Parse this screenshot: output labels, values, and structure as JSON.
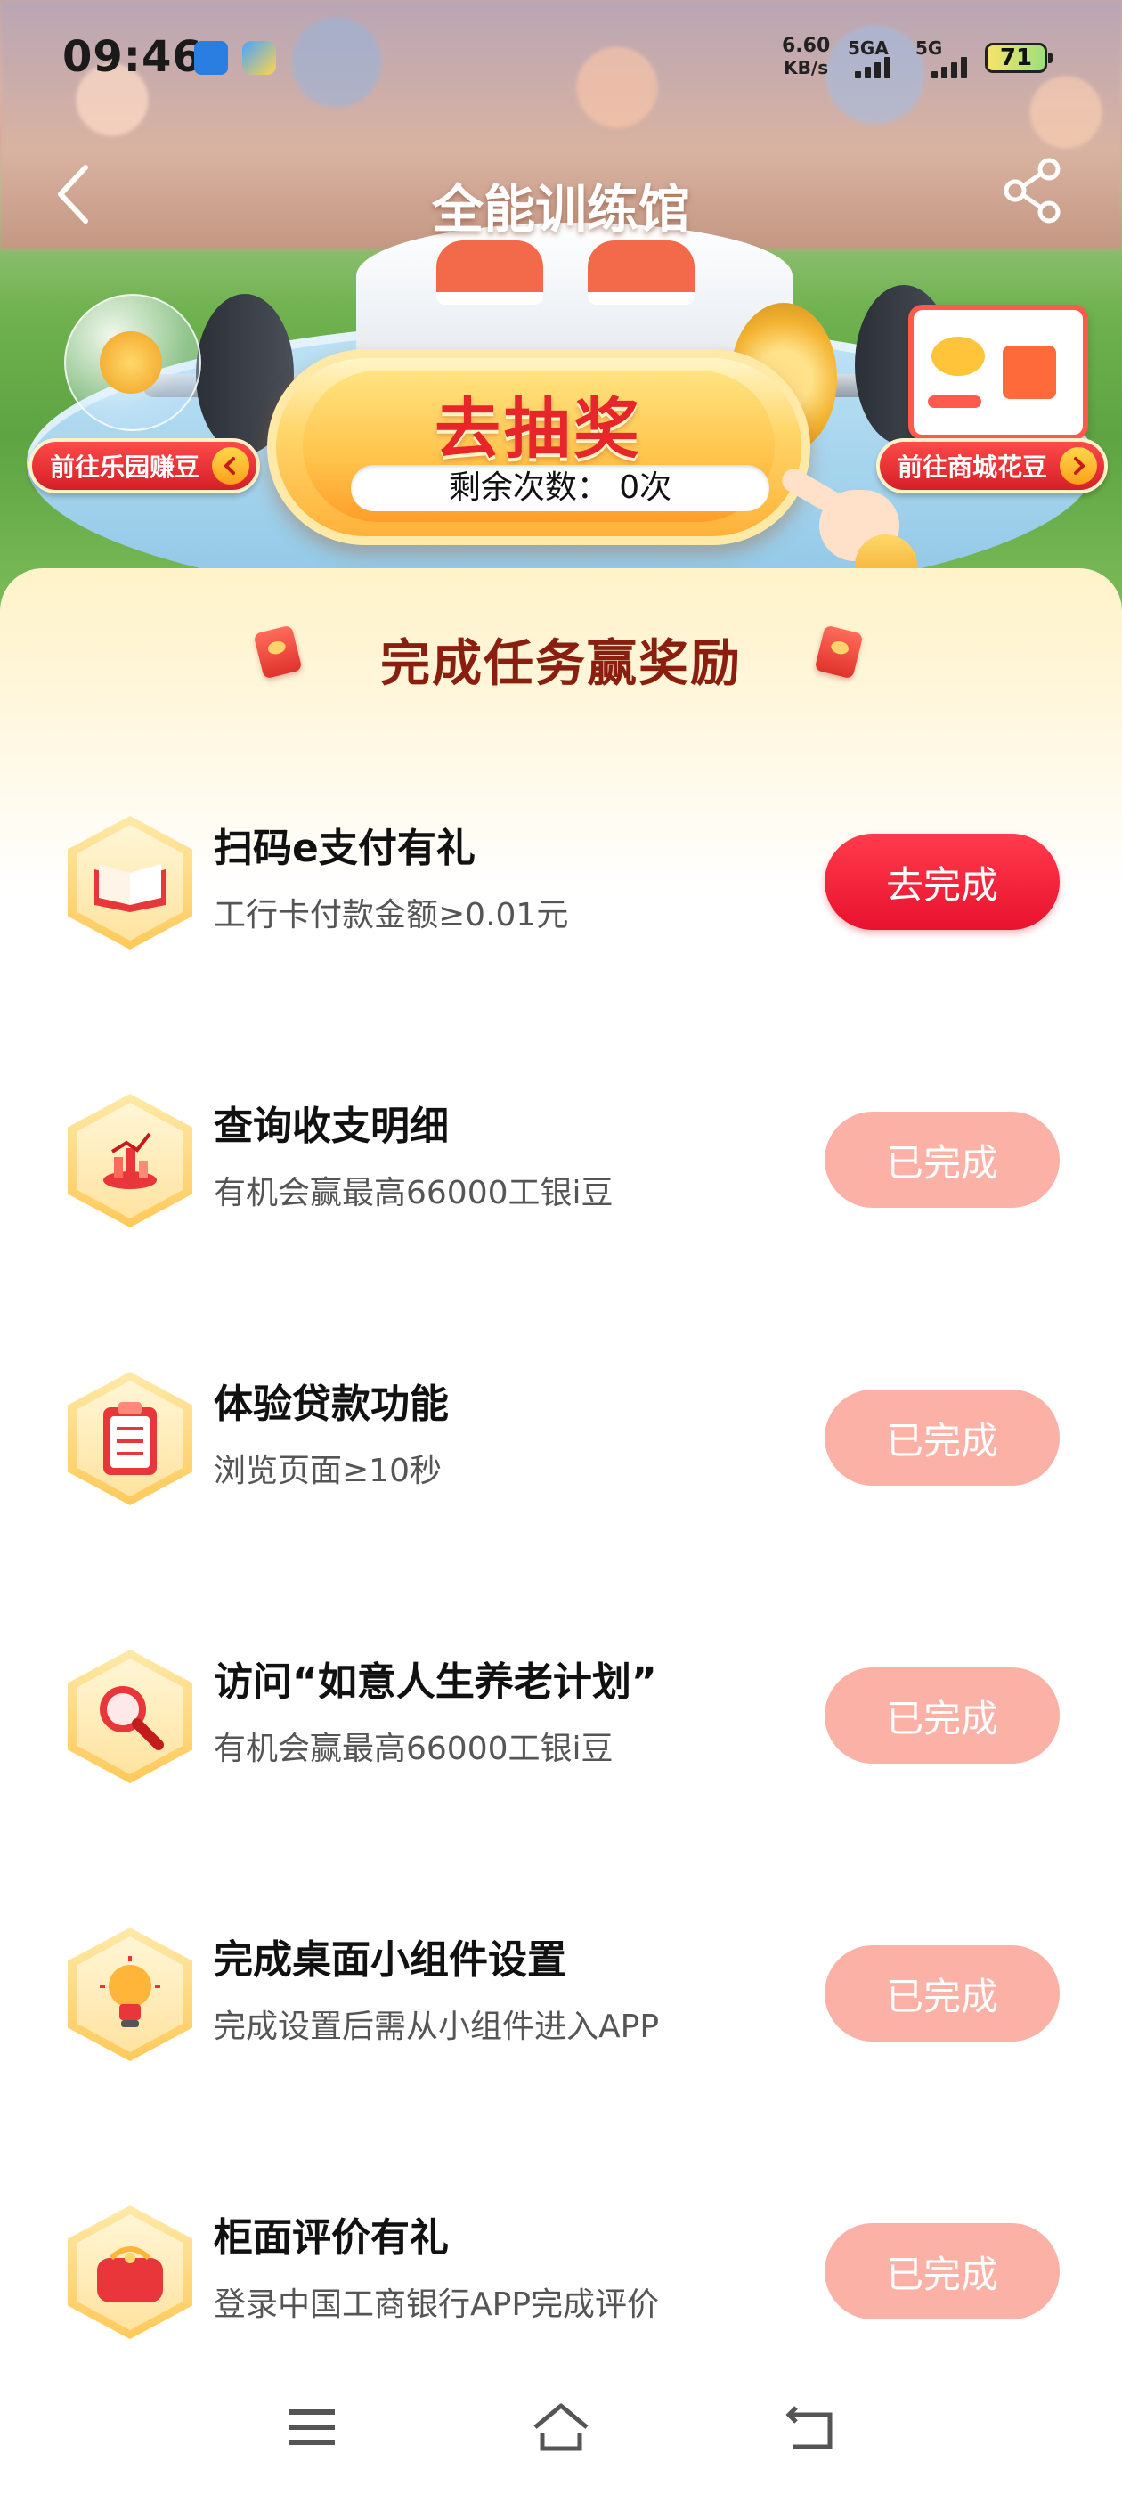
{
  "status_bar": {
    "time": "09:46",
    "net_speed_value": "6.60",
    "net_speed_unit": "KB/s",
    "network_1": "5GA",
    "network_2": "5G",
    "battery": "71"
  },
  "nav": {
    "title": "全能训练馆"
  },
  "hero": {
    "left_link": "前往乐园赚豆",
    "right_link": "前往商城花豆",
    "lottery_title": "去抽奖",
    "remaining": "剩余次数： 0次"
  },
  "tasks_panel": {
    "title": "完成任务赢奖励",
    "tasks": [
      {
        "title": "扫码e支付有礼",
        "desc": "工行卡付款金额≥0.01元",
        "button": "去完成",
        "icon": "book-icon"
      },
      {
        "title": "查询收支明细",
        "desc": "有机会赢最高66000工银i豆",
        "button": "已完成",
        "icon": "chart-icon"
      },
      {
        "title": "体验贷款功能",
        "desc": "浏览页面≥10秒",
        "button": "已完成",
        "icon": "clipboard-icon"
      },
      {
        "title": "访问“如意人生养老计划”",
        "desc": "有机会赢最高66000工银i豆",
        "button": "已完成",
        "icon": "magnifier-icon"
      },
      {
        "title": "完成桌面小组件设置",
        "desc": "完成设置后需从小组件进入APP",
        "button": "已完成",
        "icon": "lightbulb-icon"
      },
      {
        "title": "柜面评价有礼",
        "desc": "登录中国工商银行APP完成评价",
        "button": "已完成",
        "icon": "purse-icon"
      }
    ]
  },
  "colors": {
    "primary_red": "#e8122e",
    "done_pink": "#fcb1a7",
    "title_brown": "#8a1f0f"
  }
}
